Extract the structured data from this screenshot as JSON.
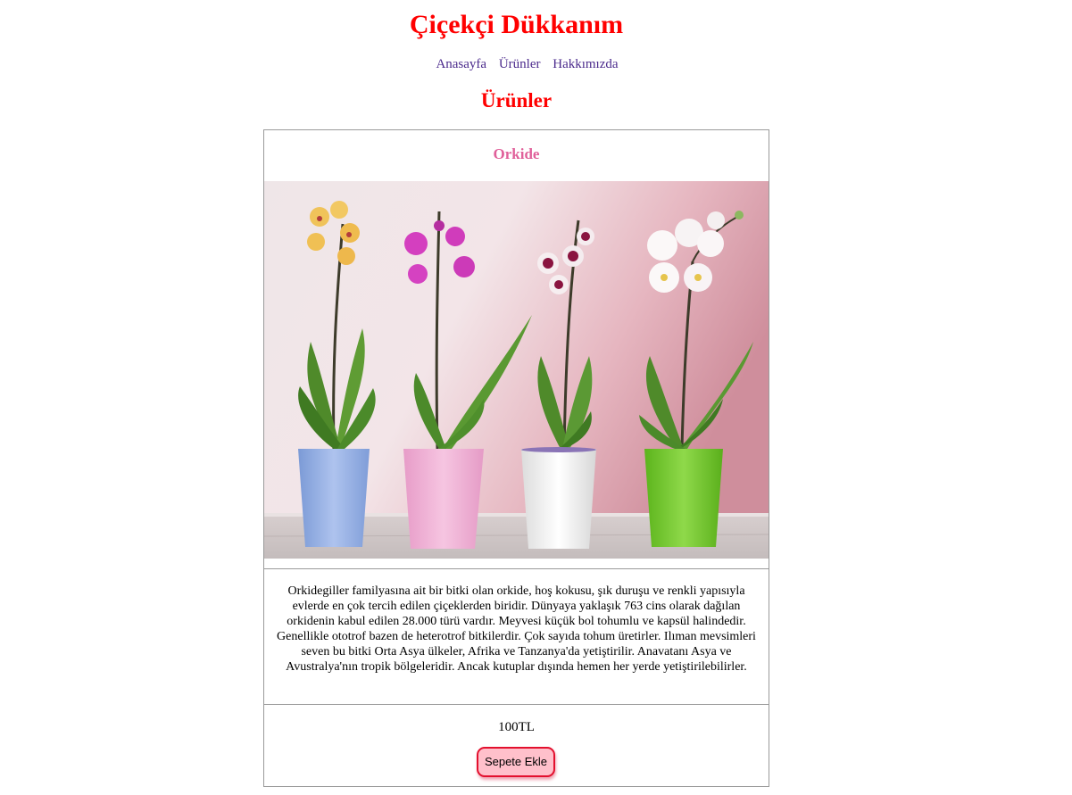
{
  "site": {
    "title": "Çiçekçi Dükkanım"
  },
  "nav": {
    "items": [
      {
        "label": "Anasayfa"
      },
      {
        "label": "Ürünler"
      },
      {
        "label": "Hakkımızda"
      }
    ]
  },
  "page": {
    "section_title": "Ürünler"
  },
  "product": {
    "name": "Orkide",
    "description": "Orkidegiller familyasına ait bir bitki olan orkide, hoş kokusu, şık duruşu ve renkli yapısıyla evlerde en çok tercih edilen çiçeklerden biridir. Dünyaya yaklaşık 763 cins olarak dağılan orkidenin kabul edilen 28.000 türü vardır. Meyvesi küçük bol tohumlu ve kapsül halindedir. Genellikle ototrof bazen de heterotrof bitkilerdir. Çok sayıda tohum üretirler. Ilıman mevsimleri seven bu bitki Orta Asya ülkeler, Afrika ve Tanzanya'da yetiştirilir. Anavatanı Asya ve Avustralya'nın tropik bölgeleridir. Ancak kutuplar dışında hemen her yerde yetiştirilebilirler.",
    "price": "100TL",
    "cart_button_label": "Sepete Ekle"
  },
  "colors": {
    "title": "#ff0000",
    "nav_link": "#4b2a8c",
    "product_name": "#e0609a",
    "button_bg": "#ffc0cb",
    "button_border": "#e3102e"
  }
}
